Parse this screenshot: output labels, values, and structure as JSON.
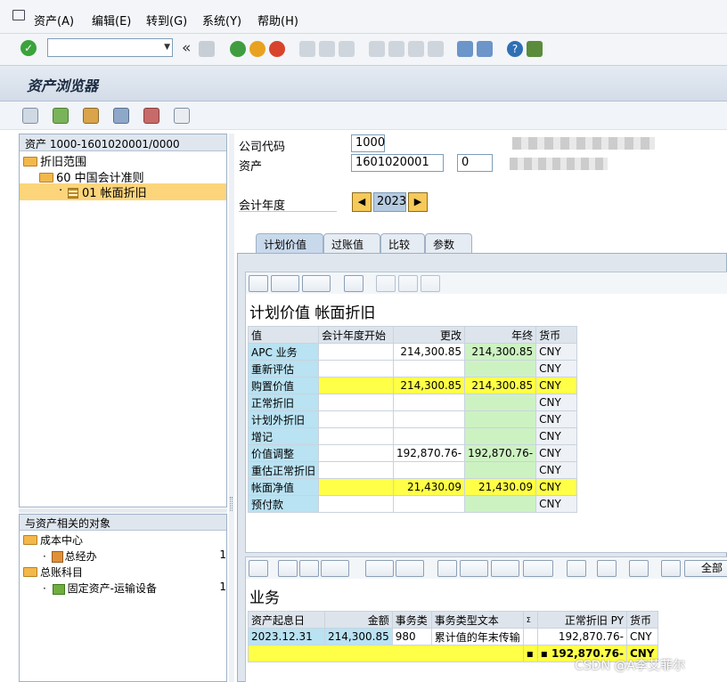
{
  "menu": {
    "items": [
      "资产(A)",
      "编辑(E)",
      "转到(G)",
      "系统(Y)",
      "帮助(H)"
    ]
  },
  "toolbar": {
    "back_glyph": "«"
  },
  "title": "资产浏览器",
  "tree": {
    "header": "资产 1000-1601020001/0000",
    "nodes": [
      "折旧范围",
      "60  中国会计准则",
      "01  帐面折旧"
    ]
  },
  "related": {
    "header": "与资产相关的对象",
    "nodes": [
      "成本中心",
      "总经办",
      "总账科目",
      "固定资产-运输设备"
    ],
    "suffix": [
      "1",
      "1"
    ]
  },
  "form": {
    "company_code_label": "公司代码",
    "company_code": "1000",
    "asset_label": "资产",
    "asset_main": "1601020001",
    "asset_sub": "0",
    "fiscal_year_label": "会计年度",
    "fiscal_year": "2023"
  },
  "tabs": [
    "计划价值",
    "过账值",
    "比较",
    "参数"
  ],
  "planned": {
    "title": "计划价值 帐面折旧",
    "columns": [
      "值",
      "会计年度开始",
      "更改",
      "年终",
      "货币"
    ],
    "rows": [
      {
        "name": "APC 业务",
        "start": "",
        "change": "214,300.85",
        "end": "214,300.85",
        "cur": "CNY",
        "highlight": false
      },
      {
        "name": "重新评估",
        "start": "",
        "change": "",
        "end": "",
        "cur": "CNY",
        "highlight": false
      },
      {
        "name": "购置价值",
        "start": "",
        "change": "214,300.85",
        "end": "214,300.85",
        "cur": "CNY",
        "highlight": true
      },
      {
        "name": "正常折旧",
        "start": "",
        "change": "",
        "end": "",
        "cur": "CNY",
        "highlight": false
      },
      {
        "name": "计划外折旧",
        "start": "",
        "change": "",
        "end": "",
        "cur": "CNY",
        "highlight": false
      },
      {
        "name": "增记",
        "start": "",
        "change": "",
        "end": "",
        "cur": "CNY",
        "highlight": false
      },
      {
        "name": "价值调整",
        "start": "",
        "change": "192,870.76-",
        "end": "192,870.76-",
        "cur": "CNY",
        "highlight": false
      },
      {
        "name": "重估正常折旧",
        "start": "",
        "change": "",
        "end": "",
        "cur": "CNY",
        "highlight": false
      },
      {
        "name": "帐面净值",
        "start": "",
        "change": "21,430.09",
        "end": "21,430.09",
        "cur": "CNY",
        "highlight": true
      },
      {
        "name": "预付款",
        "start": "",
        "change": "",
        "end": "",
        "cur": "CNY",
        "highlight": false
      }
    ]
  },
  "transactions": {
    "title": "业务",
    "all_button": "全部",
    "columns": [
      "资产起息日",
      "金额",
      "事务类",
      "事务类型文本",
      "Σ",
      "正常折旧 PY",
      "货币"
    ],
    "rows": [
      {
        "date": "2023.12.31",
        "amount": "214,300.85",
        "type": "980",
        "text": "累计值的年末传输",
        "sigma": "",
        "dep": "192,870.76-",
        "cur": "CNY"
      }
    ],
    "total": {
      "sigma": "▪",
      "dep": "▪ 192,870.76-",
      "cur": "CNY"
    }
  },
  "watermark": "CSDN @A李艾菲尔"
}
